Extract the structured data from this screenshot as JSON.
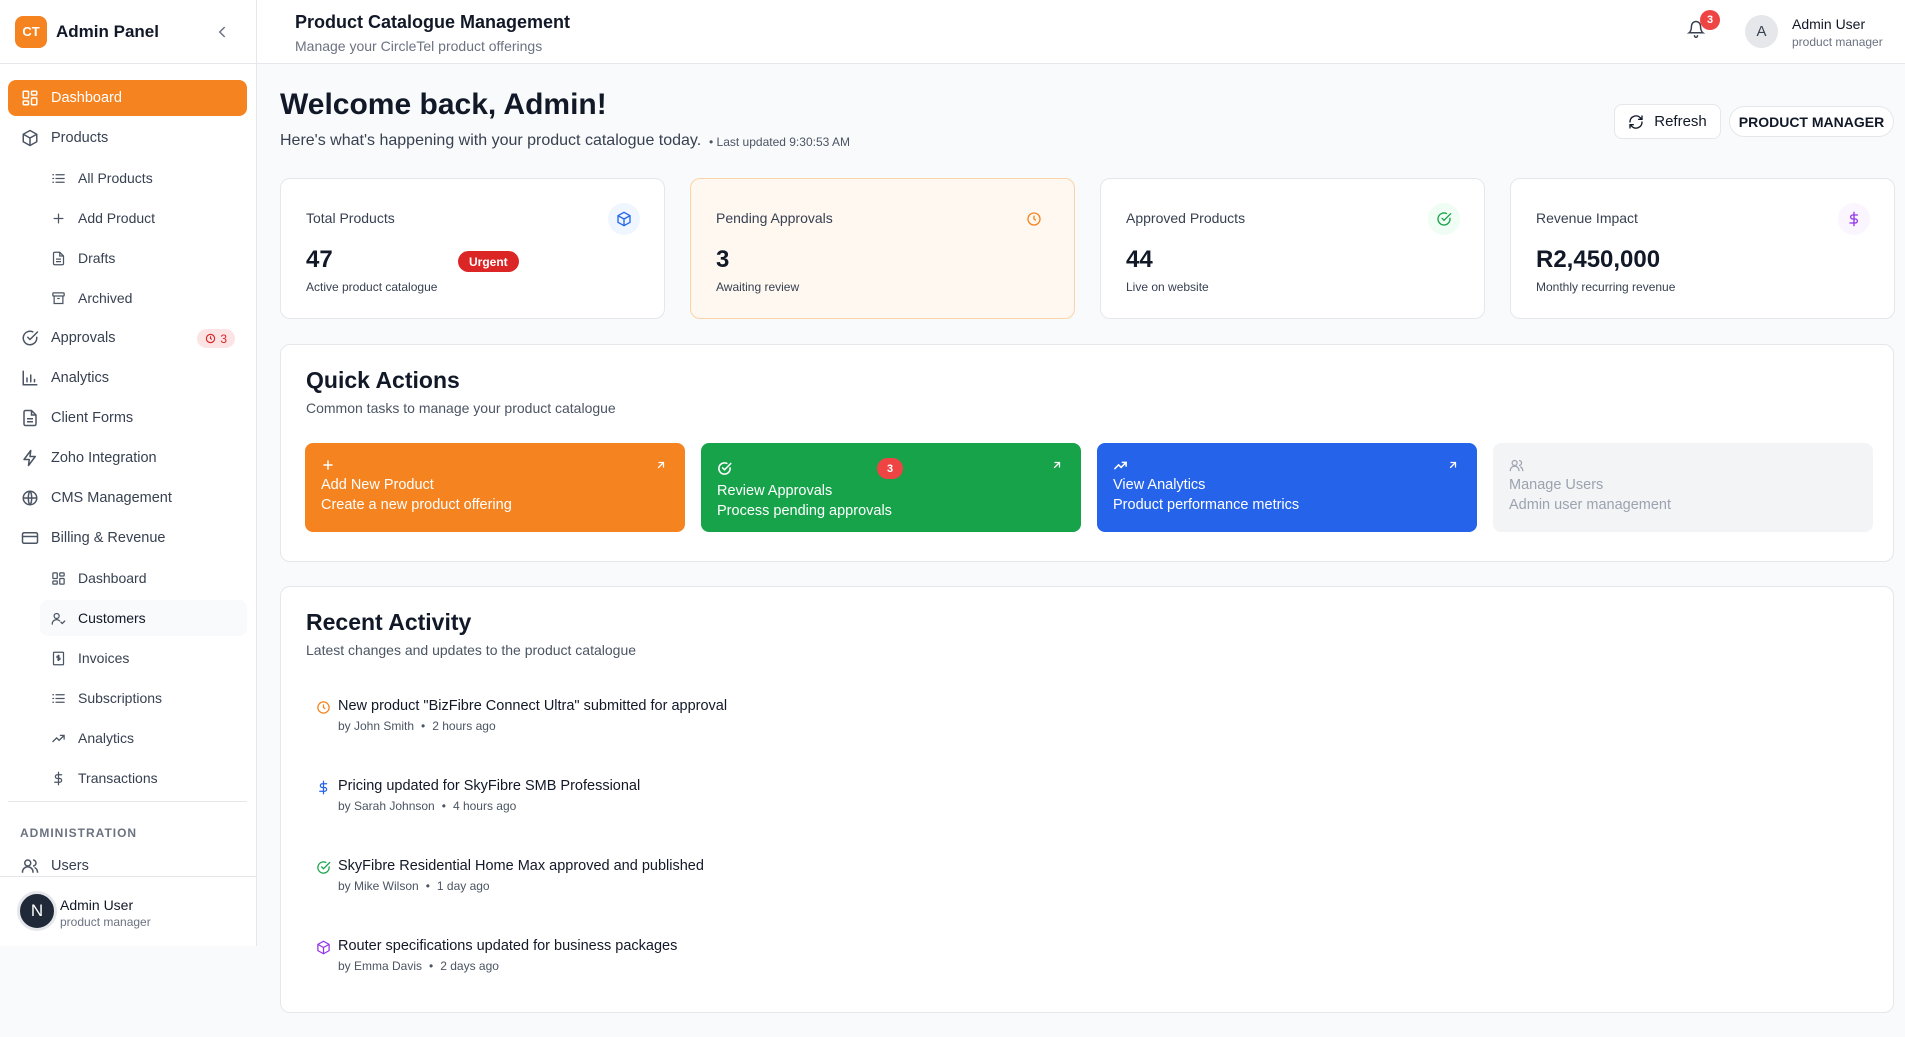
{
  "sidebar": {
    "logo": "CT",
    "title": "Admin Panel",
    "items": [
      {
        "label": "Dashboard"
      },
      {
        "label": "Products"
      },
      {
        "label": "All Products"
      },
      {
        "label": "Add Product"
      },
      {
        "label": "Drafts"
      },
      {
        "label": "Archived"
      },
      {
        "label": "Approvals",
        "badge": "3"
      },
      {
        "label": "Analytics"
      },
      {
        "label": "Client Forms"
      },
      {
        "label": "Zoho Integration"
      },
      {
        "label": "CMS Management"
      },
      {
        "label": "Billing & Revenue"
      },
      {
        "label": "Dashboard"
      },
      {
        "label": "Customers"
      },
      {
        "label": "Invoices"
      },
      {
        "label": "Subscriptions"
      },
      {
        "label": "Analytics"
      },
      {
        "label": "Transactions"
      },
      {
        "label": "Users"
      }
    ],
    "section_admin": "ADMINISTRATION",
    "user": {
      "initial": "N",
      "name": "Admin User",
      "role": "product manager"
    }
  },
  "header": {
    "title": "Product Catalogue Management",
    "subtitle": "Manage your CircleTel product offerings",
    "notifications": "3",
    "user": {
      "initial": "A",
      "name": "Admin User",
      "role": "product manager"
    }
  },
  "main": {
    "welcome": "Welcome back, Admin!",
    "welcome_sub": "Here's what's happening with your product catalogue today.",
    "last_updated": "• Last updated 9:30:53 AM",
    "refresh_label": "Refresh",
    "role_pill": "PRODUCT MANAGER",
    "stats": [
      {
        "label": "Total Products",
        "value": "47",
        "desc": "Active product catalogue",
        "color": "#2563eb"
      },
      {
        "label": "Pending Approvals",
        "value": "3",
        "badge": "Urgent",
        "desc": "Awaiting review",
        "color": "#f5831f"
      },
      {
        "label": "Approved Products",
        "value": "44",
        "desc": "Live on website",
        "color": "#16a34a"
      },
      {
        "label": "Revenue Impact",
        "value": "R2,450,000",
        "desc": "Monthly recurring revenue",
        "color": "#9333ea"
      }
    ],
    "quick_actions": {
      "title": "Quick Actions",
      "subtitle": "Common tasks to manage your product catalogue",
      "items": [
        {
          "title": "Add New Product",
          "desc": "Create a new product offering",
          "color": "#f5831f"
        },
        {
          "title": "Review Approvals",
          "desc": "Process pending approvals",
          "badge": "3",
          "color": "#16a34a"
        },
        {
          "title": "View Analytics",
          "desc": "Product performance metrics",
          "color": "#2563eb"
        },
        {
          "title": "Manage Users",
          "desc": "Admin user management",
          "color": "#f3f4f6"
        }
      ]
    },
    "recent_activity": {
      "title": "Recent Activity",
      "subtitle": "Latest changes and updates to the product catalogue",
      "items": [
        {
          "text": "New product \"BizFibre Connect Ultra\" submitted for approval",
          "by": "by John Smith",
          "time": "2 hours ago",
          "icon": "clock-icon",
          "color": "#f5831f"
        },
        {
          "text": "Pricing updated for SkyFibre SMB Professional",
          "by": "by Sarah Johnson",
          "time": "4 hours ago",
          "icon": "dollar-icon",
          "color": "#2563eb"
        },
        {
          "text": "SkyFibre Residential Home Max approved and published",
          "by": "by Mike Wilson",
          "time": "1 day ago",
          "icon": "check-circle-icon",
          "color": "#16a34a"
        },
        {
          "text": "Router specifications updated for business packages",
          "by": "by Emma Davis",
          "time": "2 days ago",
          "icon": "package-icon",
          "color": "#9333ea"
        }
      ]
    }
  }
}
